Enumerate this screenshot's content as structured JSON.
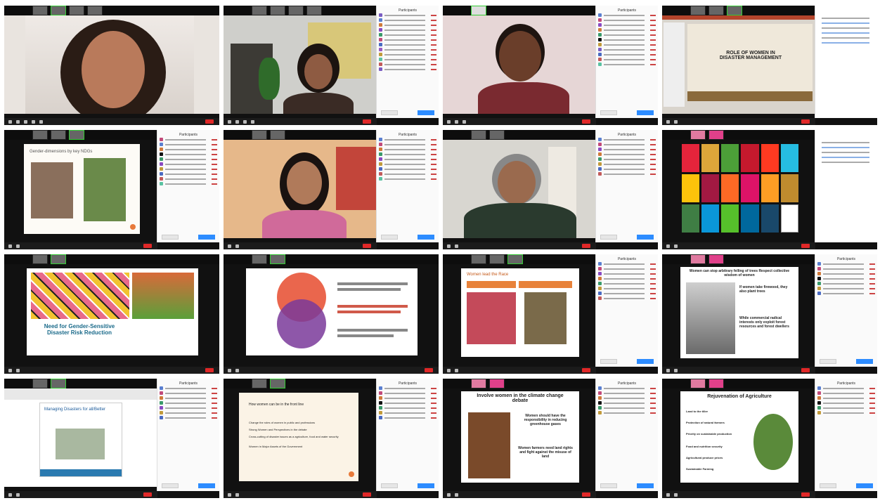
{
  "tiles": [
    {
      "id": "t1",
      "kind": "video",
      "panel": false
    },
    {
      "id": "t2",
      "kind": "video",
      "panel": true
    },
    {
      "id": "t3",
      "kind": "video",
      "panel": true
    },
    {
      "id": "t4",
      "kind": "slide",
      "panel": true,
      "slide": {
        "title": "ROLE OF WOMEN IN DISASTER MANAGEMENT"
      }
    },
    {
      "id": "t5",
      "kind": "slide",
      "panel": true,
      "slide": {
        "title": "Gender-dimensions by key NDGs"
      }
    },
    {
      "id": "t6",
      "kind": "video",
      "panel": true
    },
    {
      "id": "t7",
      "kind": "video",
      "panel": true
    },
    {
      "id": "t8",
      "kind": "sdg",
      "panel": true
    },
    {
      "id": "t9",
      "kind": "slide",
      "panel": false,
      "slide": {
        "title": "Need for Gender-Sensitive Disaster Risk Reduction"
      }
    },
    {
      "id": "t10",
      "kind": "venn",
      "panel": false
    },
    {
      "id": "t11",
      "kind": "slide",
      "panel": true,
      "slide": {
        "title": "Women lead the Race"
      }
    },
    {
      "id": "t12",
      "kind": "slide",
      "panel": true,
      "slide": {
        "title": "Women can stop arbitrary felling of trees Respect collective wisdom of women",
        "bullets": [
          "If women take firewood, they also plant trees",
          "While commercial radical interests only exploit forest resources and forest dwellers"
        ]
      }
    },
    {
      "id": "t13",
      "kind": "slide",
      "panel": true,
      "slide": {
        "title": "Managing Disasters for all/Better"
      }
    },
    {
      "id": "t14",
      "kind": "slide",
      "panel": true,
      "slide": {
        "title": "How women can be in the front line",
        "bullets": [
          "Change the roles of women in public and professions",
          "Strong Women and Perspectives in the debate",
          "Cross-cutting of disaster issues as a agriculture, food and water security",
          "Women in Major Assets of the Government"
        ]
      }
    },
    {
      "id": "t15",
      "kind": "slide",
      "panel": true,
      "slide": {
        "title": "Involve women in the climate change debate",
        "bullets": [
          "Women should have the responsibility in reducing greenhouse gases",
          "Women farmers need land rights and fight against the misuse of land"
        ]
      }
    },
    {
      "id": "t16",
      "kind": "slide",
      "panel": true,
      "slide": {
        "title": "Rejuvenation of Agriculture",
        "bullets": [
          "Land to the tiller",
          "Protection of natural farmers",
          "Priority on sustainable production",
          "Food and nutrition security",
          "Agricultural produce prices",
          "Sustainable Farming"
        ]
      }
    }
  ],
  "sdg_colors": [
    "#e5243b",
    "#dda63a",
    "#4c9f38",
    "#c5192d",
    "#ff3a21",
    "#26bde2",
    "#fcc30b",
    "#a21942",
    "#fd6925",
    "#dd1367",
    "#fd9d24",
    "#bf8b2e",
    "#3f7e44",
    "#0a97d9",
    "#56c02b",
    "#00689d",
    "#19486a",
    "#ffffff"
  ],
  "colors": {
    "end_button": "#e02828",
    "zoom_blue": "#2d8cff",
    "active_speaker": "#33cc33"
  }
}
